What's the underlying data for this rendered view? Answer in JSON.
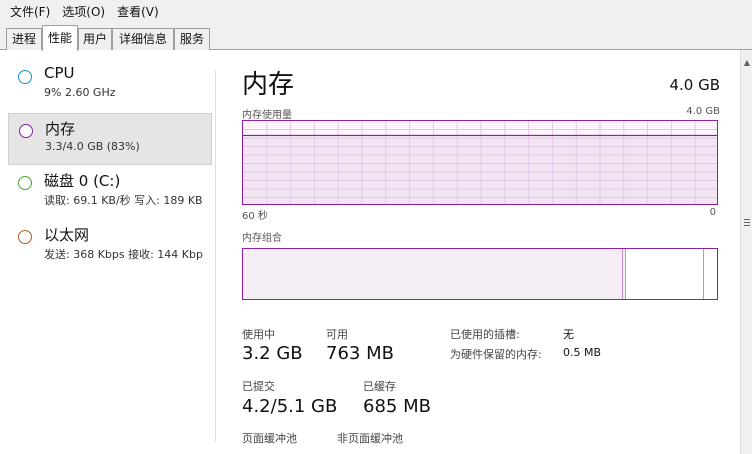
{
  "menu": {
    "items": [
      "文件(F)",
      "选项(O)",
      "查看(V)"
    ]
  },
  "tabs": [
    "进程",
    "性能",
    "用户",
    "详细信息",
    "服务"
  ],
  "active_tab": "性能",
  "sidebar": {
    "items": [
      {
        "title": "CPU",
        "sub": "9%  2.60 GHz",
        "color": "#1a8fd1",
        "selected": false
      },
      {
        "title": "内存",
        "sub": "3.3/4.0 GB (83%)",
        "color": "#8b20a0",
        "selected": true
      },
      {
        "title": "磁盘 0 (C:)",
        "sub": "读取: 69.1 KB/秒  写入: 189 KB",
        "color": "#4aa02c",
        "selected": false
      },
      {
        "title": "以太网",
        "sub": "发送: 368 Kbps  接收: 144 Kbp",
        "color": "#b35a1f",
        "selected": false
      }
    ]
  },
  "main": {
    "title": "内存",
    "total": "4.0 GB",
    "usage_label": "内存使用量",
    "usage_max": "4.0 GB",
    "time_left": "60 秒",
    "time_right": "0",
    "composition_label": "内存组合",
    "usage_fraction": 0.83,
    "composition": {
      "in_use_fraction": 0.8,
      "modified_fraction": 0.005,
      "standby_fraction": 0.165
    },
    "stats": {
      "in_use_label": "使用中",
      "in_use_value": "3.2 GB",
      "available_label": "可用",
      "available_value": "763 MB",
      "committed_label": "已提交",
      "committed_value": "4.2/5.1 GB",
      "cached_label": "已缓存",
      "cached_value": "685 MB",
      "slots_label": "已使用的插槽:",
      "slots_value": "无",
      "reserved_label": "为硬件保留的内存:",
      "reserved_value": "0.5 MB",
      "paged_label": "页面缓冲池",
      "nonpaged_label": "非页面缓冲池"
    }
  },
  "colors": {
    "memory": "#8b20a0",
    "graph_fill": "#f3e4f3"
  }
}
